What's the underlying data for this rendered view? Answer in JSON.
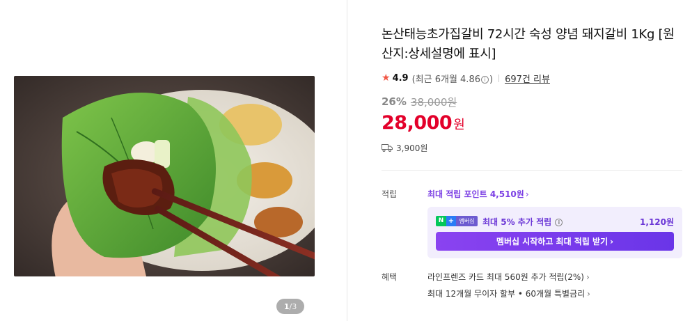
{
  "gallery": {
    "image_alt": "",
    "current_page": "1",
    "separator": "/",
    "total_pages": "3"
  },
  "product": {
    "title": "논산태능초가집갈비 72시간 숙성 양념 돼지갈비 1Kg [원산지:상세설명에 표시]",
    "rating": "4.9",
    "rating_detail_prefix": "(최근 6개월 4.86",
    "rating_detail_suffix": ")",
    "review_count": "697건 리뷰",
    "discount_rate": "26%",
    "original_price": "38,000원",
    "price": "28,000",
    "price_unit": "원",
    "shipping_fee": "3,900원"
  },
  "points": {
    "label": "적립",
    "max_points_text": "최대 적립 포인트 4,510원",
    "membership": {
      "badge_n": "N",
      "badge_plus": "+",
      "badge_label": "멤버십",
      "text": "최대 5% 추가 적립",
      "amount": "1,120원",
      "button_label": "멤버십 시작하고 최대 적립 받기"
    }
  },
  "benefits": {
    "label": "혜택",
    "items": [
      "라인프렌즈 카드 최대 560원 추가 적립(2%)",
      "최대 12개월 무이자 할부 • 60개월 특별금리"
    ]
  },
  "colors": {
    "price_red": "#e3002a",
    "star": "#f15746",
    "membership_purple": "#7b3fe4",
    "membership_bg": "#f2eefd"
  }
}
